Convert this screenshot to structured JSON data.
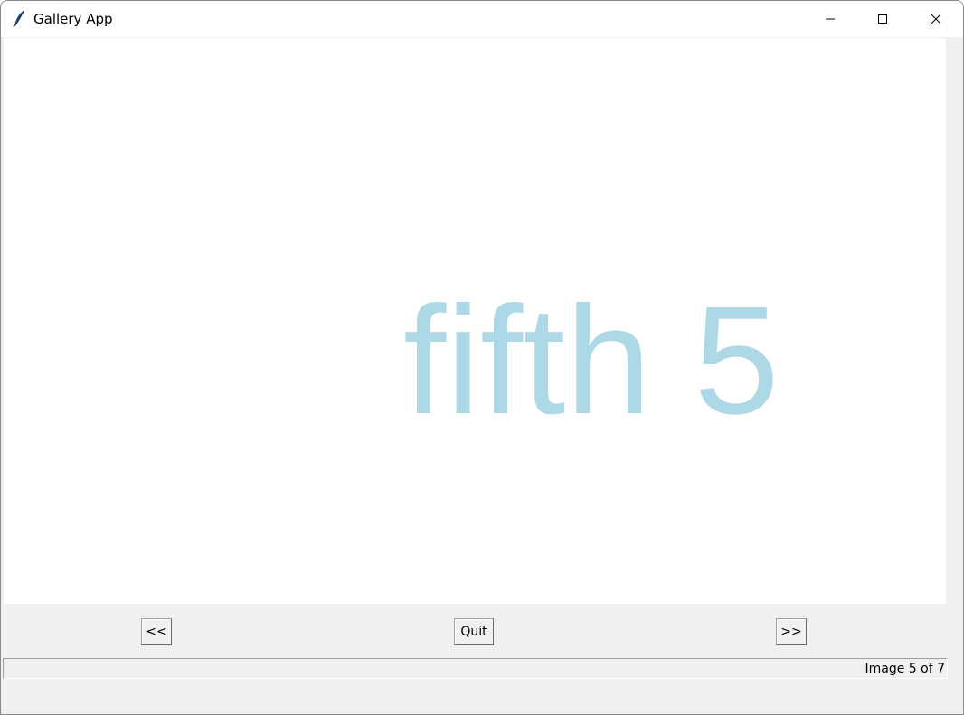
{
  "window": {
    "title": "Gallery App",
    "icon": "feather-icon"
  },
  "titlebar_controls": {
    "minimize_icon": "minimize-icon",
    "maximize_icon": "maximize-icon",
    "close_icon": "close-icon"
  },
  "image": {
    "text": "fifth 5",
    "color": "#add8e6"
  },
  "buttons": {
    "prev_label": "<<",
    "quit_label": "Quit",
    "next_label": ">>"
  },
  "status": {
    "text": "Image 5 of 7"
  },
  "colors": {
    "window_bg": "#f0f0f0",
    "canvas_bg": "#ffffff",
    "image_text": "#add8e6"
  }
}
